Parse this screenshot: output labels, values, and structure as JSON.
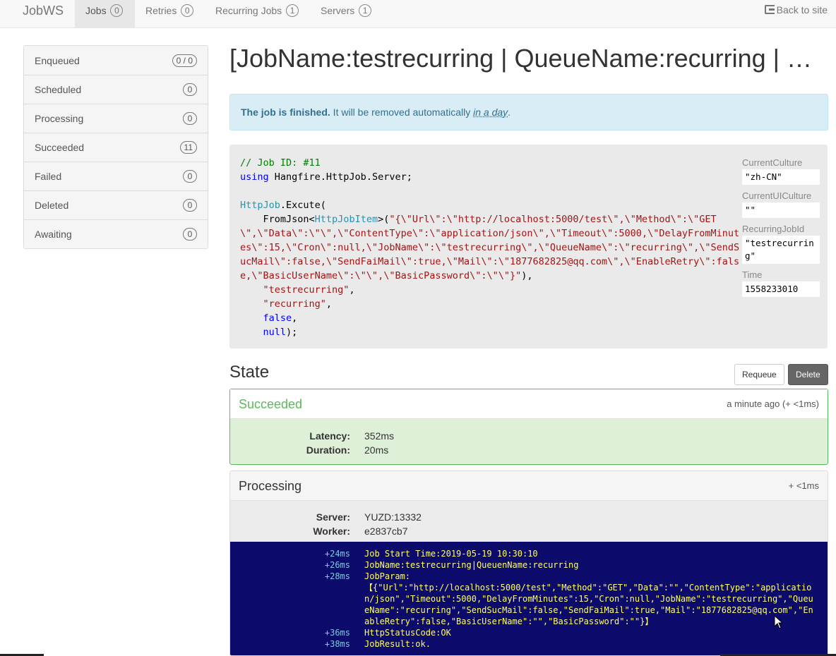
{
  "navbar": {
    "brand": "JobWS",
    "items": [
      {
        "label": "Jobs",
        "count": "0"
      },
      {
        "label": "Retries",
        "count": "0"
      },
      {
        "label": "Recurring Jobs",
        "count": "1"
      },
      {
        "label": "Servers",
        "count": "1"
      }
    ],
    "back_label": "Back to site"
  },
  "sidebar": {
    "items": [
      {
        "label": "Enqueued",
        "count": "0 / 0"
      },
      {
        "label": "Scheduled",
        "count": "0"
      },
      {
        "label": "Processing",
        "count": "0"
      },
      {
        "label": "Succeeded",
        "count": "11"
      },
      {
        "label": "Failed",
        "count": "0"
      },
      {
        "label": "Deleted",
        "count": "0"
      },
      {
        "label": "Awaiting",
        "count": "0"
      }
    ]
  },
  "page": {
    "title": "[JobName:testrecurring | QueueName:recurring | Excute]",
    "alert_strong": "The job is finished.",
    "alert_text": " It will be removed automatically ",
    "alert_time": "in a day",
    "alert_end": "."
  },
  "code": {
    "comment": "// Job ID: #11",
    "using_kw": "using",
    "using_ns": " Hangfire.HttpJob.Server;",
    "class_name": "HttpJob",
    "method": ".Excute(",
    "from_json": "    FromJson<",
    "type_arg": "HttpJobItem",
    "json_open": ">(",
    "json_string": "\"{\\\"Url\\\":\\\"http://localhost:5000/test\\\",\\\"Method\\\":\\\"GET\\\",\\\"Data\\\":\\\"\\\",\\\"ContentType\\\":\\\"application/json\\\",\\\"Timeout\\\":5000,\\\"DelayFromMinutes\\\":15,\\\"Cron\\\":null,\\\"JobName\\\":\\\"testrecurring\\\",\\\"QueueName\\\":\\\"recurring\\\",\\\"SendSucMail\\\":false,\\\"SendFaiMail\\\":true,\\\"Mail\\\":\\\"1877682825@qq.com\\\",\\\"EnableRetry\\\":false,\\\"BasicUserName\\\":\\\"\\\",\\\"BasicPassword\\\":\\\"\\\"}\"",
    "json_close": "),",
    "arg1": "\"testrecurring\"",
    "arg2": "\"recurring\"",
    "arg3": "false",
    "arg4": "null"
  },
  "params": [
    {
      "label": "CurrentCulture",
      "value": "\"zh-CN\""
    },
    {
      "label": "CurrentUICulture",
      "value": "\"\""
    },
    {
      "label": "RecurringJobId",
      "value": "\"testrecurring\""
    },
    {
      "label": "Time",
      "value": "1558233010"
    }
  ],
  "state": {
    "heading": "State",
    "requeue_label": "Requeue",
    "delete_label": "Delete",
    "succeeded": {
      "title": "Succeeded",
      "time": "a minute ago (+ <1ms)",
      "latency_label": "Latency:",
      "latency": "352ms",
      "duration_label": "Duration:",
      "duration": "20ms"
    },
    "processing": {
      "title": "Processing",
      "time": "+ <1ms",
      "server_label": "Server:",
      "server": "YUZD:13332",
      "worker_label": "Worker:",
      "worker": "e2837cb7",
      "log": [
        {
          "t": "+24ms",
          "m": "Job Start Time:2019-05-19 10:30:10"
        },
        {
          "t": "+26ms",
          "m": "JobName:testrecurring|QueuenName:recurring"
        },
        {
          "t": "+28ms",
          "m": "JobParam:\n【{\"Url\":\"http://localhost:5000/test\",\"Method\":\"GET\",\"Data\":\"\",\"ContentType\":\"application/json\",\"Timeout\":5000,\"DelayFromMinutes\":15,\"Cron\":null,\"JobName\":\"testrecurring\",\"QueueName\":\"recurring\",\"SendSucMail\":false,\"SendFaiMail\":true,\"Mail\":\"1877682825@qq.com\",\"EnableRetry\":false,\"BasicUserName\":\"\",\"BasicPassword\":\"\"}】"
        },
        {
          "t": "+36ms",
          "m": "HttpStatusCode:OK"
        },
        {
          "t": "+38ms",
          "m": "JobResult:ok."
        }
      ]
    }
  },
  "colors": {
    "success_border": "#5cb85c",
    "console_bg": "#0c0a6b",
    "console_text": "#ffff66"
  }
}
